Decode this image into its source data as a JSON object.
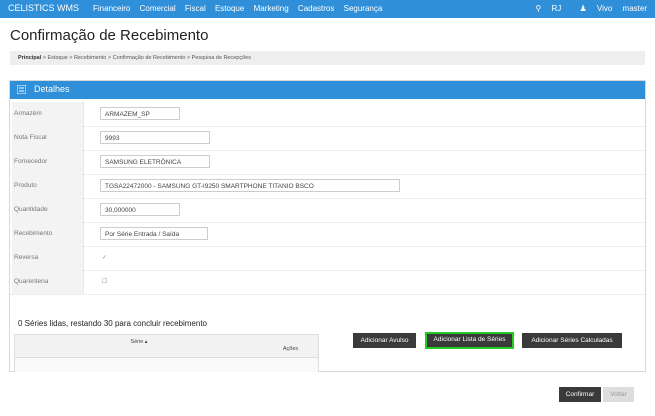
{
  "app": {
    "brand": "CELISTICS WMS",
    "menu": [
      "Financeiro",
      "Comercial",
      "Fiscal",
      "Estoque",
      "Marketing",
      "Cadastros",
      "Segurança"
    ],
    "location": "RJ",
    "user_group": "Vivo",
    "user": "master"
  },
  "page": {
    "title": "Confirmação de Recebimento",
    "breadcrumb_root": "Principal",
    "breadcrumb_rest": " > Estoque > Recebimento > Confirmação de Recebimento > Pesquisa de Recepções"
  },
  "panel": {
    "title": "Detalhes",
    "fields": {
      "armazem": {
        "label": "Armazém",
        "value": "ARMAZEM_SP"
      },
      "nota": {
        "label": "Nota Fiscal",
        "value": "9993"
      },
      "fornecedor": {
        "label": "Fornecedor",
        "value": "SAMSUNG ELETRÔNICA"
      },
      "produto": {
        "label": "Produto",
        "value": "TGSA22472000 - SAMSUNG GT-I9250 SMARTPHONE TITANIO BSCO"
      },
      "quantidade": {
        "label": "Quantidade",
        "value": "30,000000"
      },
      "recebimento": {
        "label": "Recebimento",
        "value": "Por Série Entrada / Saída"
      },
      "reversa": {
        "label": "Reversa",
        "value": "✓"
      },
      "quarentena": {
        "label": "Quarentena",
        "value": "☐"
      }
    },
    "status": "0 Séries lidas, restando 30 para concluir recebimento",
    "table": {
      "col_serie": "Série ▴",
      "col_acoes": "Ações"
    },
    "buttons": {
      "avulso": "Adicionar Avulso",
      "lista": "Adicionar Lista de Séries",
      "calculadas": "Adicionar Séries Calculadas"
    }
  },
  "footer": {
    "confirmar": "Confirmar",
    "voltar": "Voltar"
  }
}
